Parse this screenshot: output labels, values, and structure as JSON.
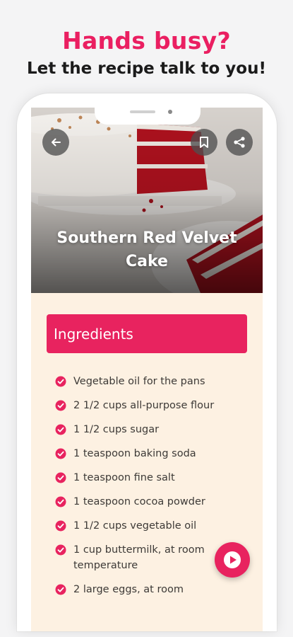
{
  "promo": {
    "headline": "Hands busy?",
    "subline": "Let the recipe talk to you!"
  },
  "recipe": {
    "title_lines": [
      "Southern Red Velvet",
      "Cake"
    ],
    "section_title": "Ingredients",
    "ingredients": [
      [
        "Vegetable oil for the pans"
      ],
      [
        "2 1/2 cups all-purpose flour"
      ],
      [
        "1 1/2 cups sugar"
      ],
      [
        "1 teaspoon baking soda"
      ],
      [
        "1 teaspoon fine salt"
      ],
      [
        "1 teaspoon cocoa powder"
      ],
      [
        "1 1/2 cups vegetable oil"
      ],
      [
        "1 cup buttermilk, at room",
        "temperature"
      ],
      [
        "2 large eggs, at room"
      ]
    ]
  },
  "icons": {
    "back": "arrow-left-icon",
    "bookmark": "bookmark-icon",
    "share": "share-icon",
    "play": "play-icon",
    "check": "check-circle-icon"
  },
  "colors": {
    "accent": "#e8235f",
    "content_background": "#fdf1e2"
  }
}
